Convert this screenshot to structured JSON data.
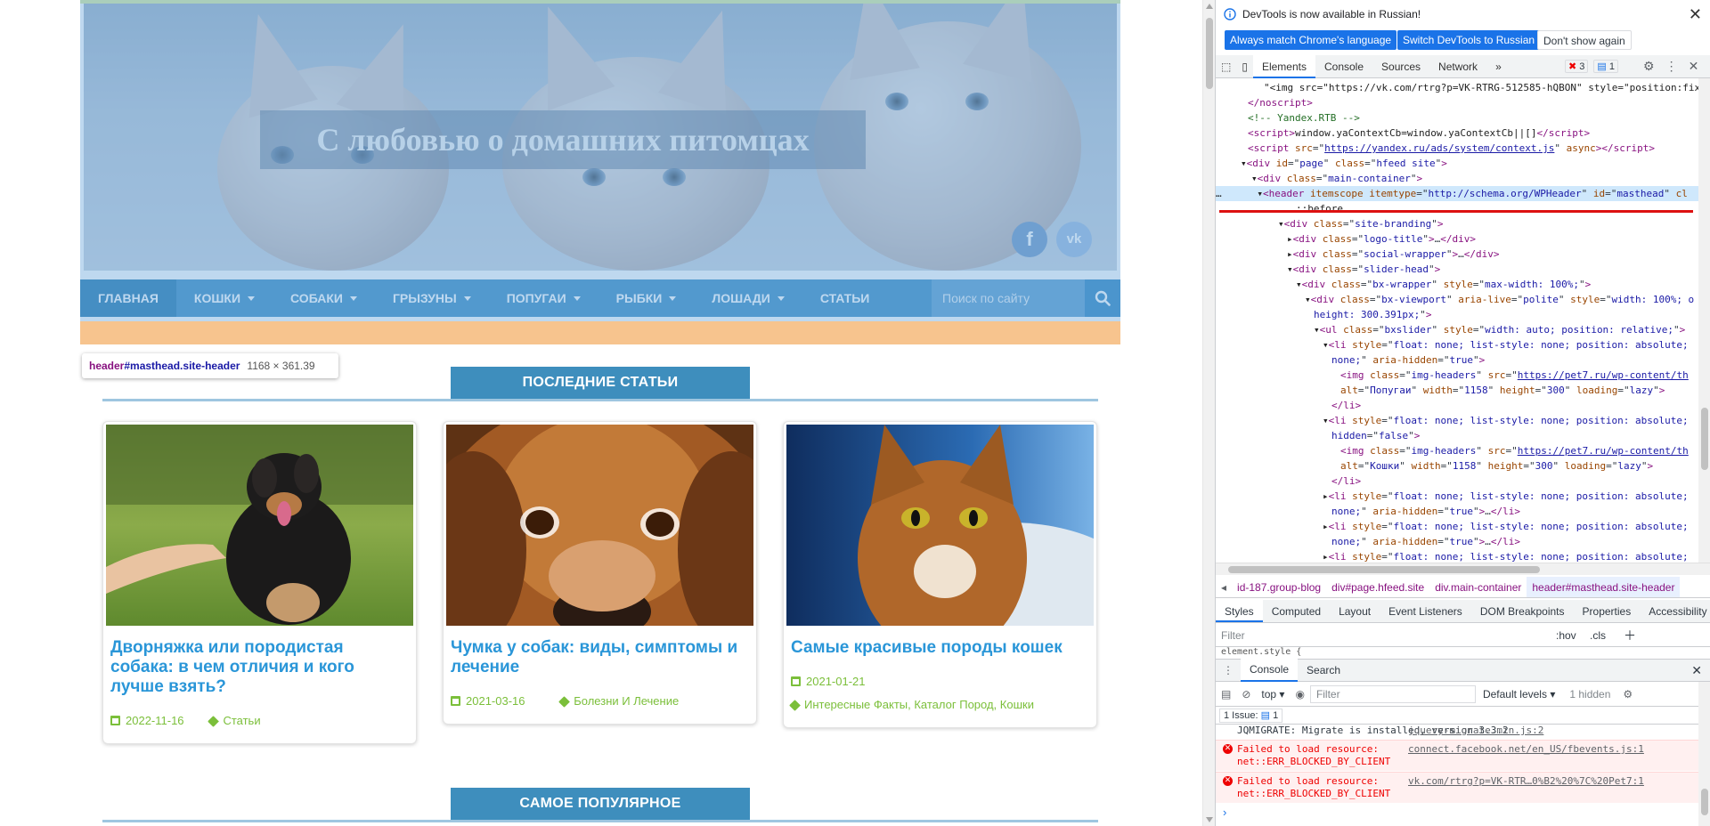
{
  "site": {
    "title": "С любовью о домашних питомцах",
    "social": {
      "fb": "f",
      "vk": "vk"
    },
    "nav": [
      {
        "label": "ГЛАВНАЯ",
        "dropdown": false,
        "active": true
      },
      {
        "label": "КОШКИ",
        "dropdown": true
      },
      {
        "label": "СОБАКИ",
        "dropdown": true
      },
      {
        "label": "ГРЫЗУНЫ",
        "dropdown": true
      },
      {
        "label": "ПОПУГАИ",
        "dropdown": true
      },
      {
        "label": "РЫБКИ",
        "dropdown": true
      },
      {
        "label": "ЛОШАДИ",
        "dropdown": true
      },
      {
        "label": "СТАТЬИ",
        "dropdown": false
      }
    ],
    "search_placeholder": "Поиск по сайту",
    "inspect_tooltip": {
      "tag": "header",
      "selector": "#masthead.site-header",
      "size": "1168 × 361.39"
    },
    "latest_heading": "ПОСЛЕДНИЕ СТАТЬИ",
    "popular_heading": "САМОЕ ПОПУЛЯРНОЕ",
    "cards": [
      {
        "title": "Дворняжка или породистая собака: в чем отличия и кого лучше взять?",
        "date": "2022-11-16",
        "category": "Статьи"
      },
      {
        "title": "Чумка у собак: виды, симптомы и лечение",
        "date": "2021-03-16",
        "category": "Болезни И Лечение"
      },
      {
        "title": "Самые красивые породы кошек",
        "date": "2021-01-21",
        "category": "Интересные Факты, Каталог Пород, Кошки"
      }
    ]
  },
  "devtools": {
    "info_text": "DevTools is now available in Russian!",
    "btn_match": "Always match Chrome's language",
    "btn_switch": "Switch DevTools to Russian",
    "btn_dont": "Don't show again",
    "tabs": [
      "Elements",
      "Console",
      "Sources",
      "Network"
    ],
    "error_count": "3",
    "msg_count": "1",
    "breadcrumbs": [
      "id-187.group-blog",
      "div#page.hfeed.site",
      "div.main-container",
      "header#masthead.site-header"
    ],
    "subtabs": [
      "Styles",
      "Computed",
      "Layout",
      "Event Listeners",
      "DOM Breakpoints",
      "Properties",
      "Accessibility"
    ],
    "filter_placeholder": "Filter",
    "hov": ":hov",
    "cls": ".cls",
    "element_style": "element.style {",
    "drawer_tabs": [
      "Console",
      "Search"
    ],
    "context": "top",
    "console_filter": "Filter",
    "levels": "Default levels",
    "hidden": "1 hidden",
    "issue_label": "1 Issue:",
    "issue_count": "1",
    "messages": [
      {
        "type": "log",
        "text": "JQMIGRATE: Migrate is installed, version 3.3.2",
        "source": "jquery-migrate.min.js:2"
      },
      {
        "type": "error",
        "text": "Failed to load resource: net::ERR_BLOCKED_BY_CLIENT",
        "source": "connect.facebook.net/en_US/fbevents.js:1"
      },
      {
        "type": "error",
        "text": "Failed to load resource: net::ERR_BLOCKED_BY_CLIENT",
        "source": "vk.com/rtrg?p=VK-RTR…0%B2%20%7C%20Pet7:1"
      }
    ],
    "code_lines": [
      {
        "indent": 3,
        "html": "&lt;/noscript&gt;"
      },
      {
        "indent": 3,
        "html": "<span class='cm'>&lt;!-- Yandex.RTB --&gt;</span>"
      },
      {
        "indent": 3,
        "html": "<span class='tg'>&lt;script&gt;</span><span class='tx'>window.yaContextCb=window.yaContextCb||[]</span><span class='tg'>&lt;/script&gt;</span>"
      },
      {
        "indent": 3,
        "html": "<span class='tg'>&lt;script </span><span class='at'>src</span>=\"<span class='lk'>https://yandex.ru/ads/system/context.js</span>\" <span class='at'>async</span><span class='tg'>&gt;&lt;/script&gt;</span>"
      }
    ]
  }
}
